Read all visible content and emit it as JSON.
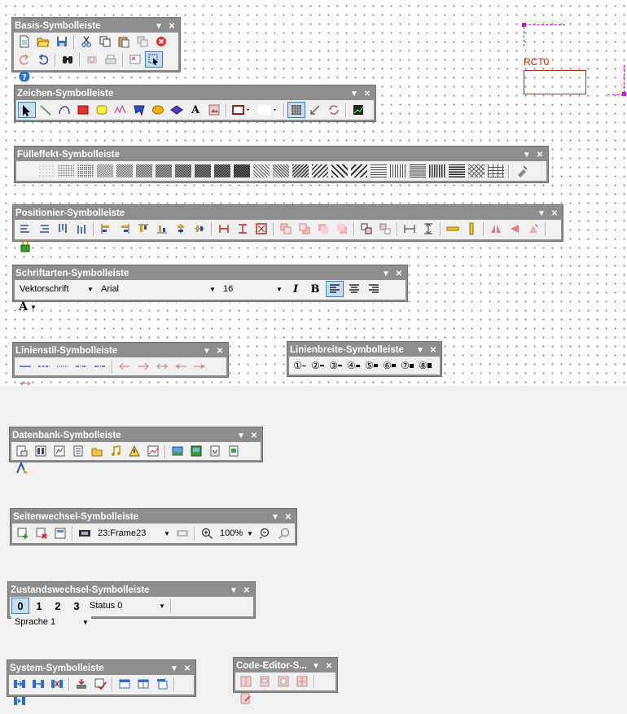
{
  "canvas": {
    "object_label": "RCT0"
  },
  "toolbars": {
    "basis": {
      "title": "Basis-Symbolleiste",
      "row1": [
        "new-document-icon",
        "open-folder-icon",
        "save-icon",
        "cut-icon",
        "copy-icon",
        "paste-icon",
        "duplicate-icon",
        "delete-icon"
      ],
      "row2": [
        "redo-icon",
        "undo-icon",
        "find-icon",
        "print-preview-icon",
        "print-icon",
        "properties-icon",
        "select-mode-icon",
        "help-icon"
      ]
    },
    "zeichen": {
      "title": "Zeichen-Symbolleiste",
      "text_tool": "A"
    },
    "fuelleffekt": {
      "title": "Fülleffekt-Symbolleiste"
    },
    "positionier": {
      "title": "Positionier-Symbolleiste"
    },
    "schriftarten": {
      "title": "Schriftarten-Symbolleiste",
      "font_type": "Vektorschrift",
      "font_name": "Arial",
      "font_size": "16",
      "italic": "I",
      "bold": "B",
      "font_color": "A"
    },
    "linienstil": {
      "title": "Linienstil-Symbolleiste"
    },
    "linienbreite": {
      "title": "Linienbreite-Symbolleiste",
      "widths": [
        "①",
        "②",
        "③",
        "④",
        "⑤",
        "⑥",
        "⑦",
        "⑧"
      ]
    },
    "datenbank": {
      "title": "Datenbank-Symbolleiste"
    },
    "seitenwechsel": {
      "title": "Seitenwechsel-Symbolleiste",
      "frame": "23:Frame23",
      "zoom": "100%"
    },
    "zustandswechsel": {
      "title": "Zustandswechsel-Symbolleiste",
      "states": [
        "0",
        "1",
        "2",
        "3"
      ],
      "status": "Status 0",
      "language": "Sprache 1"
    },
    "system": {
      "title": "System-Symbolleiste"
    },
    "code_editor": {
      "title": "Code-Editor-S..."
    }
  },
  "colors": {
    "toolbar_frame": "#8e8e8e",
    "selection": "#c4def5",
    "object": "#b03000",
    "handle": "#e000e0"
  }
}
